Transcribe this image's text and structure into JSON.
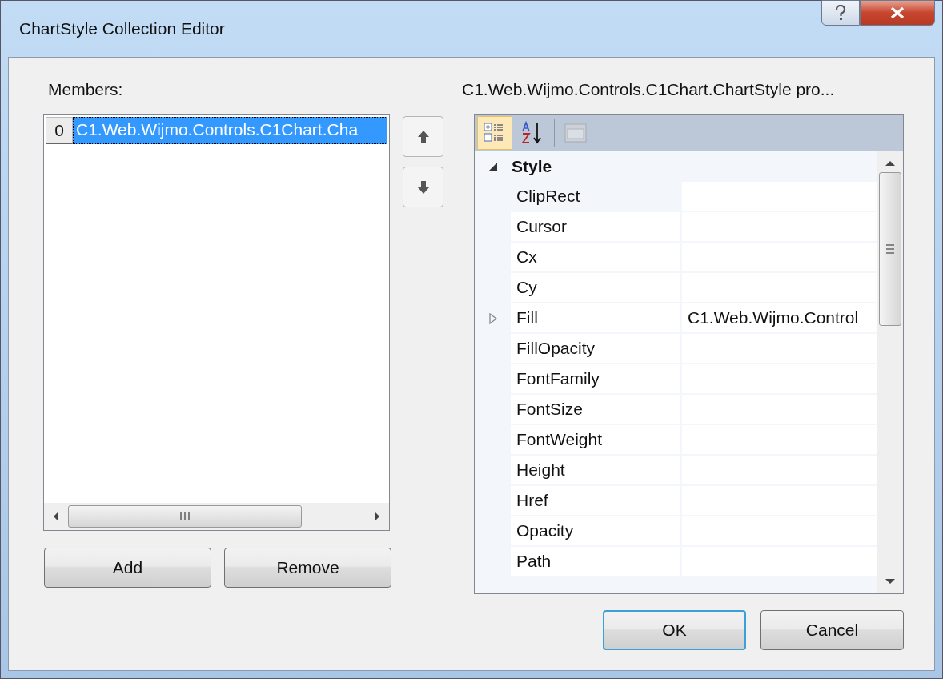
{
  "window": {
    "title": "ChartStyle Collection Editor"
  },
  "members": {
    "label": "Members:",
    "items": [
      {
        "index": "0",
        "text": "C1.Web.Wijmo.Controls.C1Chart.Cha",
        "selected": true
      }
    ]
  },
  "member_buttons": [
    "Add",
    "Remove"
  ],
  "properties": {
    "label": "C1.Web.Wijmo.Controls.C1Chart.ChartStyle pro...",
    "toolbar": [
      {
        "kind": "categorized",
        "selected": true,
        "disabled": false
      },
      {
        "kind": "alphabetical",
        "selected": false,
        "disabled": false
      },
      {
        "kind": "pages",
        "selected": false,
        "disabled": true
      }
    ],
    "category": {
      "name": "Style",
      "expanded": true
    },
    "rows": [
      {
        "name": "ClipRect",
        "selected": true,
        "expandable": false
      },
      {
        "name": "Cursor",
        "selected": false,
        "expandable": false
      },
      {
        "name": "Cx",
        "selected": false,
        "expandable": false
      },
      {
        "name": "Cy",
        "selected": false,
        "expandable": false
      },
      {
        "name": "Fill",
        "value": "C1.Web.Wijmo.Control",
        "selected": false,
        "expandable": true
      },
      {
        "name": "FillOpacity",
        "selected": false,
        "expandable": false
      },
      {
        "name": "FontFamily",
        "selected": false,
        "expandable": false
      },
      {
        "name": "FontSize",
        "selected": false,
        "expandable": false
      },
      {
        "name": "FontWeight",
        "selected": false,
        "expandable": false
      },
      {
        "name": "Height",
        "selected": false,
        "expandable": false
      },
      {
        "name": "Href",
        "selected": false,
        "expandable": false
      },
      {
        "name": "Opacity",
        "selected": false,
        "expandable": false
      },
      {
        "name": "Path",
        "selected": false,
        "expandable": false
      }
    ]
  },
  "dialog_buttons": [
    {
      "label": "OK",
      "default": true
    },
    {
      "label": "Cancel",
      "default": false
    }
  ]
}
